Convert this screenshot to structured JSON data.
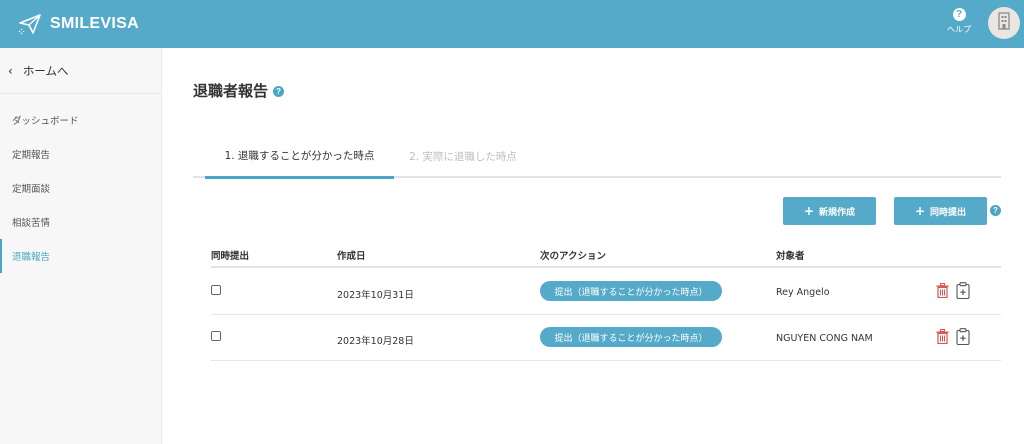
{
  "header": {
    "brand": "SMILEVISA",
    "help_label": "ヘルプ",
    "colors": {
      "bar": "#56aac9",
      "accent": "#4aa6c6",
      "delete": "#d9534f"
    }
  },
  "sidebar": {
    "home_label": "ホームへ",
    "items": [
      {
        "label": "ダッシュボード",
        "active": false
      },
      {
        "label": "定期報告",
        "active": false
      },
      {
        "label": "定期面談",
        "active": false
      },
      {
        "label": "相談苦情",
        "active": false
      },
      {
        "label": "退職報告",
        "active": true
      }
    ]
  },
  "main": {
    "title": "退職者報告",
    "tabs": [
      {
        "label": "1. 退職することが分かった時点",
        "active": true
      },
      {
        "label": "2. 実際に退職した時点",
        "active": false
      }
    ],
    "buttons": {
      "new": "新規作成",
      "simultaneous": "同時提出"
    },
    "table": {
      "columns": [
        "同時提出",
        "作成日",
        "次のアクション",
        "対象者"
      ],
      "rows": [
        {
          "checked": false,
          "date": "2023年10月31日",
          "action": "提出（退職することが分かった時点）",
          "person": "Rey Angelo"
        },
        {
          "checked": false,
          "date": "2023年10月28日",
          "action": "提出（退職することが分かった時点）",
          "person": "NGUYEN CONG NAM"
        }
      ]
    },
    "icons": [
      "paper-plane-icon",
      "help-icon",
      "building-icon",
      "chevron-left-icon",
      "question-icon",
      "trash-icon",
      "clipboard-plus-icon"
    ]
  }
}
